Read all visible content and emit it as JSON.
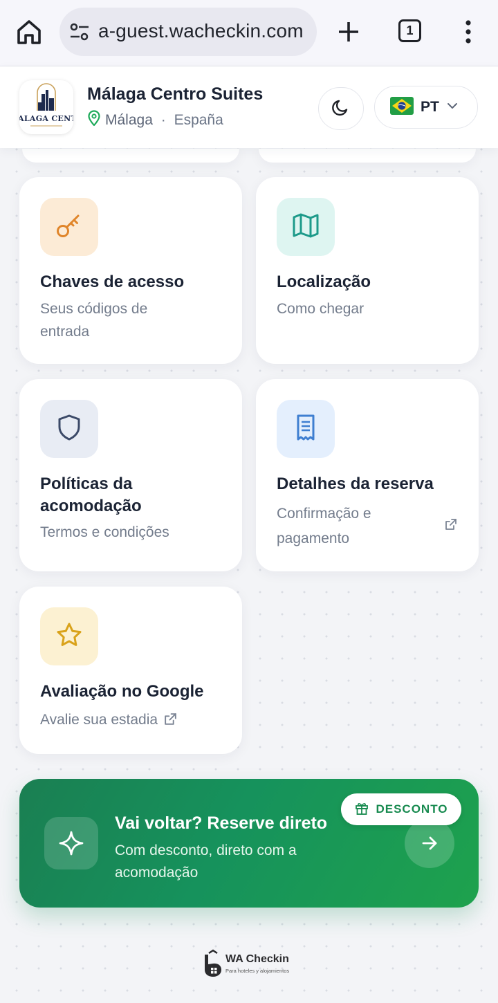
{
  "browser": {
    "url": "a-guest.wacheckin.com",
    "tab_count": "1"
  },
  "header": {
    "property_name": "Málaga Centro Suites",
    "city": "Málaga",
    "separator": " · ",
    "country": "España",
    "logo_text": "ALAGA CENTR",
    "language_code": "PT"
  },
  "cards": [
    {
      "title": "Chaves de acesso",
      "subtitle": "Seus códigos de entrada",
      "icon": "key-icon",
      "tile_color": "#fcebd6",
      "icon_color": "#e0852a"
    },
    {
      "title": "Localização",
      "subtitle": "Como chegar",
      "icon": "map-icon",
      "tile_color": "#def5f1",
      "icon_color": "#1d9a8a"
    },
    {
      "title": "Políticas da acomodação",
      "subtitle": "Termos e condições",
      "icon": "shield-icon",
      "tile_color": "#e8ecf4",
      "icon_color": "#3c4a68"
    },
    {
      "title": "Detalhes da reserva",
      "subtitle": "Confirmação e pagamento",
      "icon": "receipt-icon",
      "tile_color": "#e4effd",
      "icon_color": "#3f7fd1"
    },
    {
      "title": "Avaliação no Google",
      "subtitle": "Avalie sua estadia",
      "icon": "star-icon",
      "tile_color": "#fcf1d2",
      "icon_color": "#d9a21a"
    }
  ],
  "promo": {
    "title": "Vai voltar? Reserve direto",
    "subtitle": "Com desconto, direto com a acomodação",
    "badge": "DESCONTO",
    "color": "#16925c"
  },
  "footer": {
    "brand": "WA Checkin",
    "tagline": "Para hoteles y alojamientos"
  }
}
